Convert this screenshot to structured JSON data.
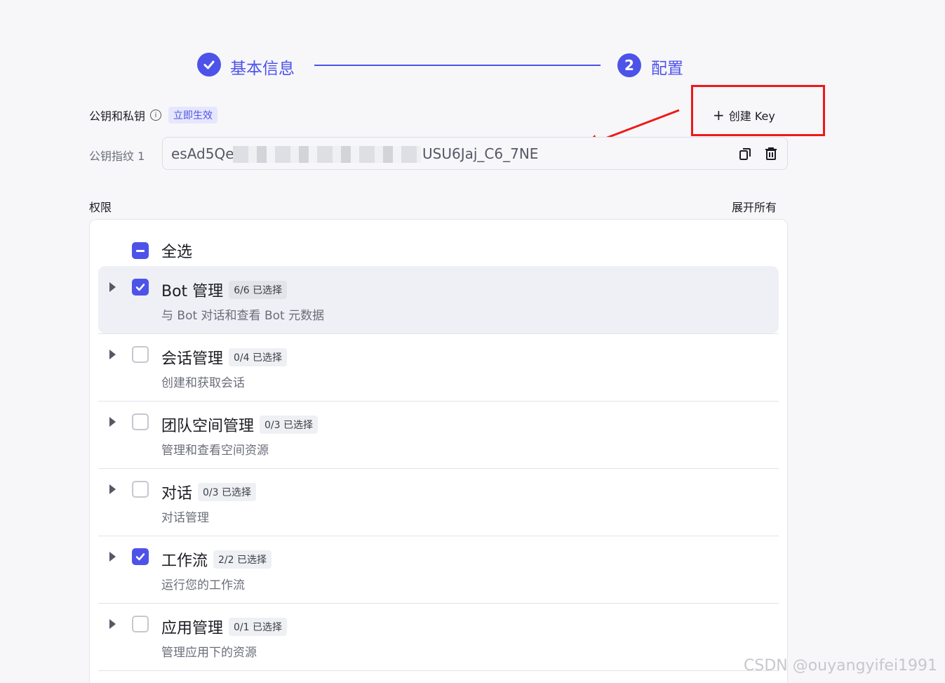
{
  "stepper": {
    "step1_label": "基本信息",
    "step2_number": "2",
    "step2_label": "配置"
  },
  "keys": {
    "title": "公钥和私钥",
    "badge": "立即生效",
    "create_label": "创建 Key",
    "fingerprint_label": "公钥指纹 1",
    "fingerprint_start": "esAd5Qe",
    "fingerprint_end": "USU6Jaj_C6_7NE"
  },
  "permissions": {
    "title": "权限",
    "expand_all": "展开所有",
    "select_all": "全选",
    "items": [
      {
        "name": "Bot 管理",
        "count": "6/6 已选择",
        "desc": "与 Bot 对话和查看 Bot 元数据",
        "checked": true
      },
      {
        "name": "会话管理",
        "count": "0/4 已选择",
        "desc": "创建和获取会话",
        "checked": false
      },
      {
        "name": "团队空间管理",
        "count": "0/3 已选择",
        "desc": "管理和查看空间资源",
        "checked": false
      },
      {
        "name": "对话",
        "count": "0/3 已选择",
        "desc": "对话管理",
        "checked": false
      },
      {
        "name": "工作流",
        "count": "2/2 已选择",
        "desc": "运行您的工作流",
        "checked": true
      },
      {
        "name": "应用管理",
        "count": "0/1 已选择",
        "desc": "管理应用下的资源",
        "checked": false
      }
    ]
  },
  "watermark": "CSDN @ouyangyifei1991",
  "colors": {
    "accent": "#4d53e8",
    "annotation_red": "#f01818"
  }
}
